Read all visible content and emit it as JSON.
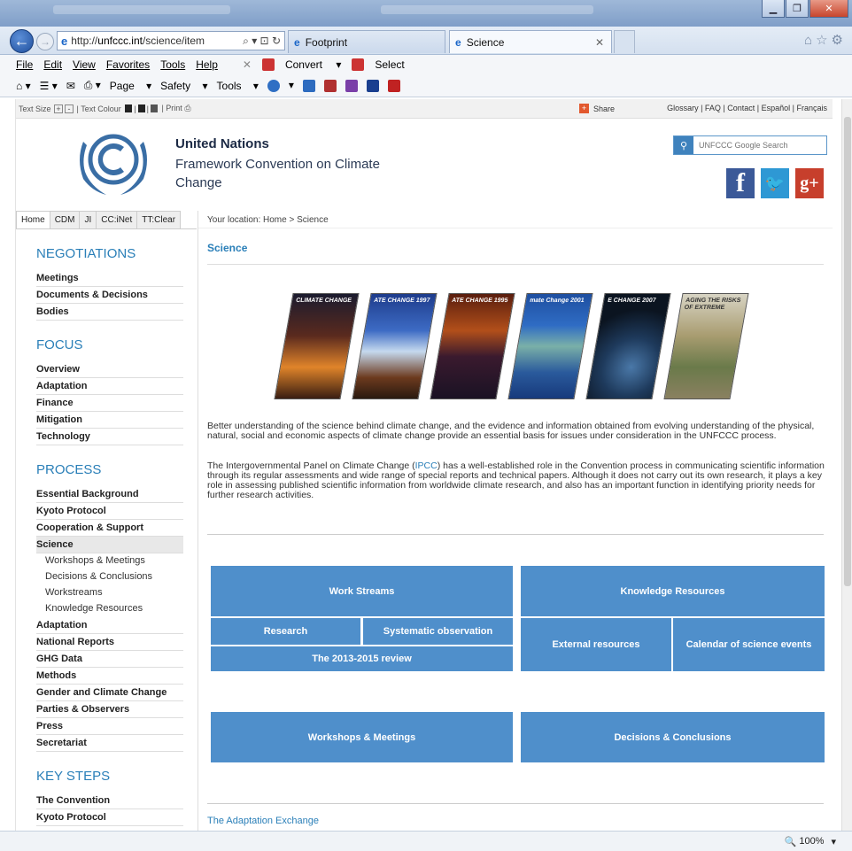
{
  "browser": {
    "address": {
      "prefix": "http://",
      "host": "unfccc.int",
      "path": "/science/item"
    },
    "tabs": [
      {
        "label": "Footprint"
      },
      {
        "label": "Science"
      }
    ],
    "menu": [
      "File",
      "Edit",
      "View",
      "Favorites",
      "Tools",
      "Help"
    ],
    "commands": {
      "convert": "Convert",
      "select": "Select",
      "page": "Page",
      "safety": "Safety",
      "tools": "Tools"
    },
    "zoom": "100%"
  },
  "util": {
    "text_size": "Text Size",
    "plus": "+",
    "minus": "-",
    "text_colour": "| Text Colour",
    "print": "| Print",
    "share": "Share",
    "links": "Glossary | FAQ | Contact | Español | Français"
  },
  "header": {
    "title": "United Nations",
    "subtitle": "Framework Convention on Climate Change",
    "search_placeholder": "UNFCCC Google Search"
  },
  "left_tabs": [
    "Home",
    "CDM",
    "JI",
    "CC:iNet",
    "TT:Clear"
  ],
  "nav": {
    "negotiations": {
      "title": "NEGOTIATIONS",
      "items": [
        "Meetings",
        "Documents & Decisions",
        "Bodies"
      ]
    },
    "focus": {
      "title": "FOCUS",
      "items": [
        "Overview",
        "Adaptation",
        "Finance",
        "Mitigation",
        "Technology"
      ]
    },
    "process": {
      "title": "PROCESS",
      "items": [
        "Essential Background",
        "Kyoto Protocol",
        "Cooperation & Support",
        "Science"
      ],
      "sub": [
        "Workshops & Meetings",
        "Decisions & Conclusions",
        "Workstreams",
        "Knowledge Resources"
      ],
      "items2": [
        "Adaptation",
        "National Reports",
        "GHG Data",
        "Methods",
        "Gender and Climate Change",
        "Parties & Observers",
        "Press",
        "Secretariat"
      ]
    },
    "keysteps": {
      "title": "KEY STEPS",
      "items": [
        "The Convention",
        "Kyoto Protocol"
      ]
    }
  },
  "main": {
    "breadcrumb": "Your location: Home > Science",
    "heading": "Science",
    "covers": [
      "CLIMATE CHANGE",
      "ATE CHANGE 1997",
      "ATE CHANGE 1995",
      "mate Change 2001",
      "E CHANGE 2007",
      "AGING THE RISKS OF EXTREME"
    ],
    "para1": "Better understanding of the science behind climate change, and the evidence and information obtained from evolving understanding of the physical, natural, social and economic aspects of climate change provide an essential basis for issues under consideration in the UNFCCC process.",
    "para2_before": "The Intergovernmental Panel on Climate Change (",
    "para2_link": "IPCC",
    "para2_after": ") has a well-established role in the Convention process in communicating scientific information through its regular assessments and wide range of special reports and technical papers. Although it does not carry out its own research, it plays a key role in assessing published scientific information from worldwide climate research, and also has an important function in identifying priority needs for further research activities.",
    "blocks": {
      "work_streams": "Work Streams",
      "research": "Research",
      "systematic": "Systematic observation",
      "review": "The 2013-2015 review",
      "knowledge": "Knowledge Resources",
      "external": "External resources",
      "calendar": "Calendar of science events",
      "workshops": "Workshops & Meetings",
      "decisions": "Decisions & Conclusions"
    },
    "adaptation_exchange": "The Adaptation Exchange"
  },
  "colors": {
    "accent": "#4f8fcb",
    "link": "#2a7fb8"
  }
}
